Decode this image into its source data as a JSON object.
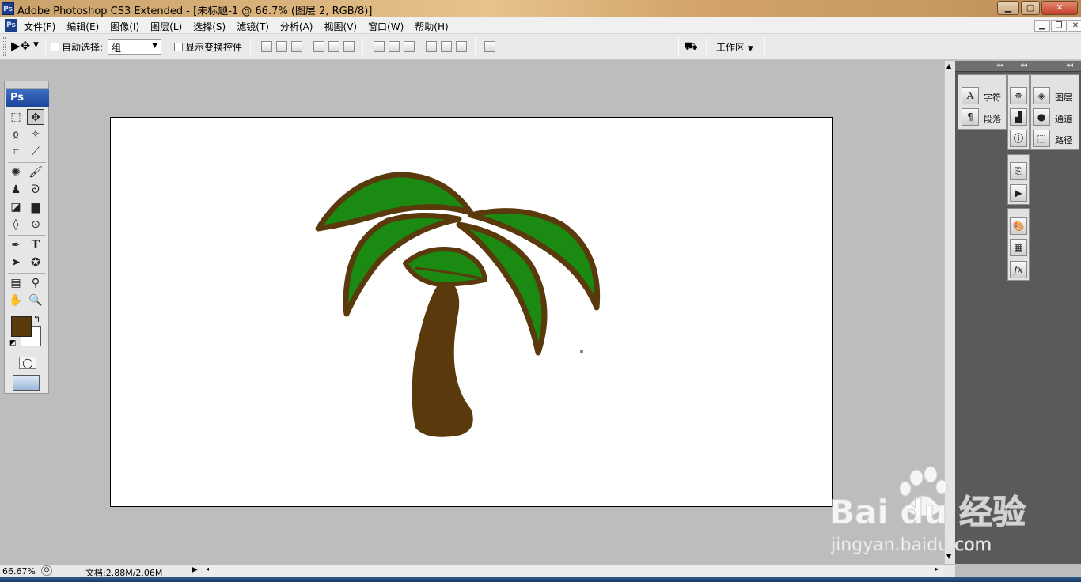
{
  "window": {
    "title": "Adobe Photoshop CS3 Extended - [未标题-1 @ 66.7% (图层 2, RGB/8)]",
    "app_icon": "Ps",
    "controls": [
      "minimize-icon",
      "maximize-icon",
      "close-icon"
    ]
  },
  "menu": {
    "items": [
      "文件(F)",
      "编辑(E)",
      "图像(I)",
      "图层(L)",
      "选择(S)",
      "滤镜(T)",
      "分析(A)",
      "视图(V)",
      "窗口(W)",
      "帮助(H)"
    ]
  },
  "options": {
    "auto_select_label": "自动选择:",
    "auto_select_value": "组",
    "show_transform_label": "显示变换控件",
    "workspace_label": "工作区"
  },
  "tools": {
    "badge": "Ps",
    "items": [
      "rect-marquee",
      "move",
      "lasso",
      "magic-wand",
      "crop",
      "slice",
      "healing",
      "brush",
      "stamp",
      "history-brush",
      "eraser",
      "gradient",
      "blur",
      "dodge",
      "pen",
      "type",
      "path-select",
      "shape",
      "notes",
      "eyedropper",
      "hand",
      "zoom"
    ],
    "foreground_color": "#5a3a0c",
    "background_color": "#ffffff"
  },
  "dock": {
    "group1": [
      {
        "icon": "character-icon",
        "label": "字符"
      },
      {
        "icon": "paragraph-icon",
        "label": "段落"
      }
    ],
    "group3": [
      {
        "icon": "layers-icon",
        "label": "图层"
      },
      {
        "icon": "channels-icon",
        "label": "通道"
      },
      {
        "icon": "paths-icon",
        "label": "路径"
      }
    ]
  },
  "status": {
    "zoom": "66.67%",
    "doc_info": "文档:2.88M/2.06M"
  },
  "watermark": {
    "brand": "Bai du 经验",
    "url": "jingyan.baidu.com"
  },
  "artwork": {
    "leaf_color": "#1a8a12",
    "outline_color": "#5a3a0c",
    "trunk_color": "#5a3a0c"
  }
}
